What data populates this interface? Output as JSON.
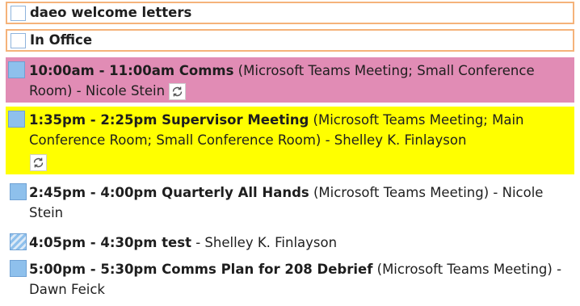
{
  "tasks": [
    {
      "label": "daeo welcome letters",
      "checked": false
    },
    {
      "label": "In Office",
      "checked": false
    }
  ],
  "events": [
    {
      "time_title": "10:00am - 11:00am Comms",
      "details": " (Microsoft Teams Meeting; Small Conference Room) - Nicole Stein",
      "background": "#e18cb5",
      "recurring": true,
      "icon": "recurring-sync-icon"
    },
    {
      "time_title": "1:35pm - 2:25pm Supervisor Meeting",
      "details": " (Microsoft Teams Meeting; Main Conference Room; Small Conference Room) - Shelley K. Finlayson",
      "background": "#ffff00",
      "recurring": true,
      "icon": "recurring-sync-icon"
    },
    {
      "time_title": "2:45pm - 4:00pm Quarterly All Hands",
      "details": " (Microsoft Teams Meeting) - Nicole Stein",
      "background": "#ffffff",
      "recurring": false
    },
    {
      "time_title": "4:05pm - 4:30pm test",
      "details": " - Shelley K. Finlayson",
      "background": "#ffffff",
      "recurring": false,
      "tentative": true
    },
    {
      "time_title": "5:00pm - 5:30pm Comms Plan for 208 Debrief",
      "details": " (Microsoft Teams Meeting) - Dawn Feick",
      "background": "#ffffff",
      "recurring": false
    }
  ],
  "colors": {
    "task_border": "#f5b37a",
    "category_blue": "#8ec0ec",
    "pink_highlight": "#e18cb5",
    "yellow_highlight": "#ffff00"
  }
}
